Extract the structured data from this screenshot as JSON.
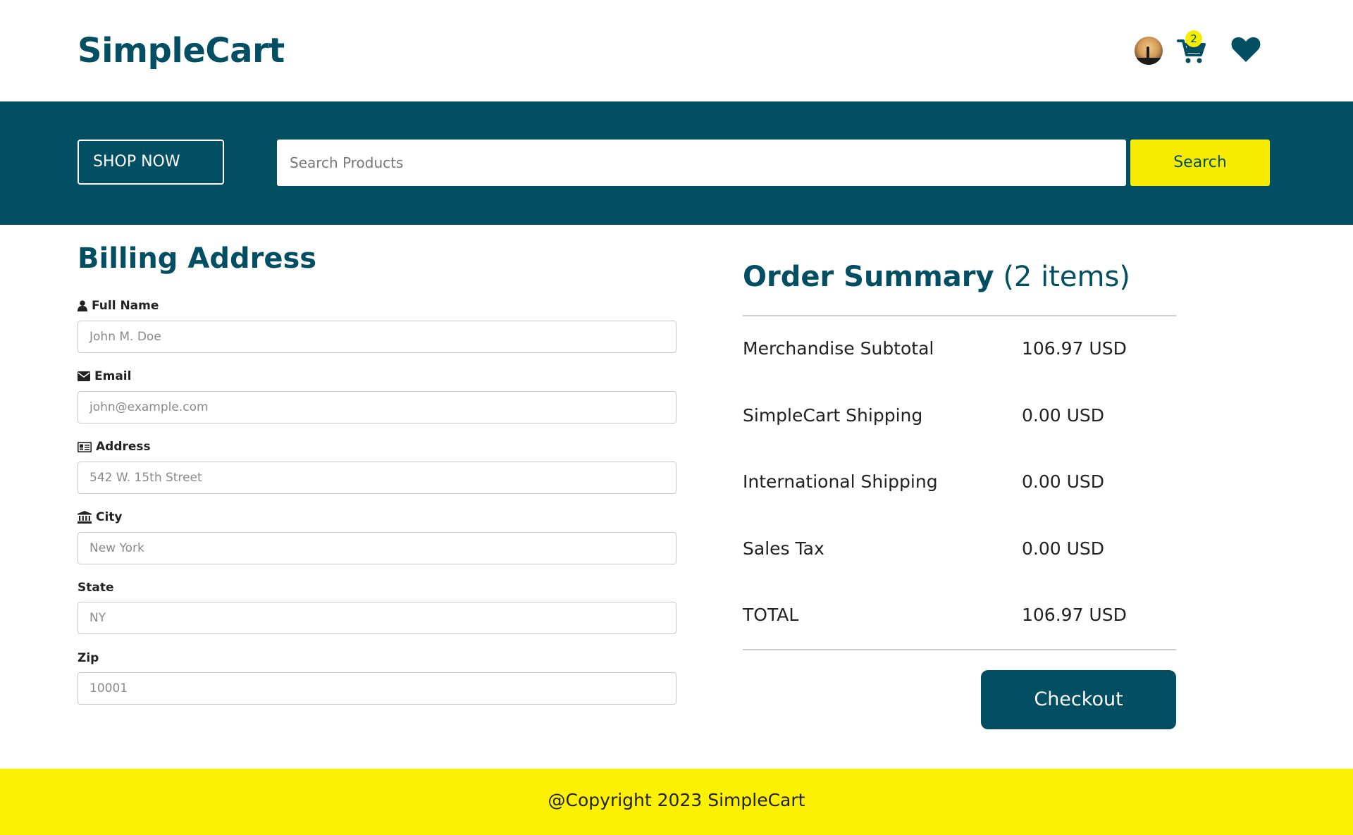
{
  "header": {
    "logo": "SimpleCart",
    "cart_count": "2",
    "colors": {
      "brand": "#024e62",
      "accent": "#f7ec00"
    },
    "icons": [
      "avatar",
      "cart-icon",
      "heart-icon"
    ]
  },
  "banner": {
    "shop_now_label": "SHOP NOW",
    "search_placeholder": "Search Products",
    "search_button_label": "Search"
  },
  "billing": {
    "title": "Billing Address",
    "fields": [
      {
        "label": "Full Name",
        "icon": "user-icon",
        "placeholder": "John M. Doe"
      },
      {
        "label": "Email",
        "icon": "envelope-icon",
        "placeholder": "john@example.com"
      },
      {
        "label": "Address",
        "icon": "address-card-icon",
        "placeholder": "542 W. 15th Street"
      },
      {
        "label": "City",
        "icon": "institution-icon",
        "placeholder": "New York"
      },
      {
        "label": "State",
        "icon": "",
        "placeholder": "NY"
      },
      {
        "label": "Zip",
        "icon": "",
        "placeholder": "10001"
      }
    ]
  },
  "summary": {
    "title": "Order Summary",
    "item_count": "(2 items)",
    "rows": [
      {
        "label": "Merchandise Subtotal",
        "value": "106.97 USD"
      },
      {
        "label": "SimpleCart Shipping",
        "value": "0.00 USD"
      },
      {
        "label": "International Shipping",
        "value": "0.00 USD"
      },
      {
        "label": "Sales Tax",
        "value": "0.00 USD"
      },
      {
        "label": "TOTAL",
        "value": "106.97 USD"
      }
    ],
    "checkout_label": "Checkout"
  },
  "footer": {
    "copyright": "@Copyright 2023 SimpleCart"
  }
}
